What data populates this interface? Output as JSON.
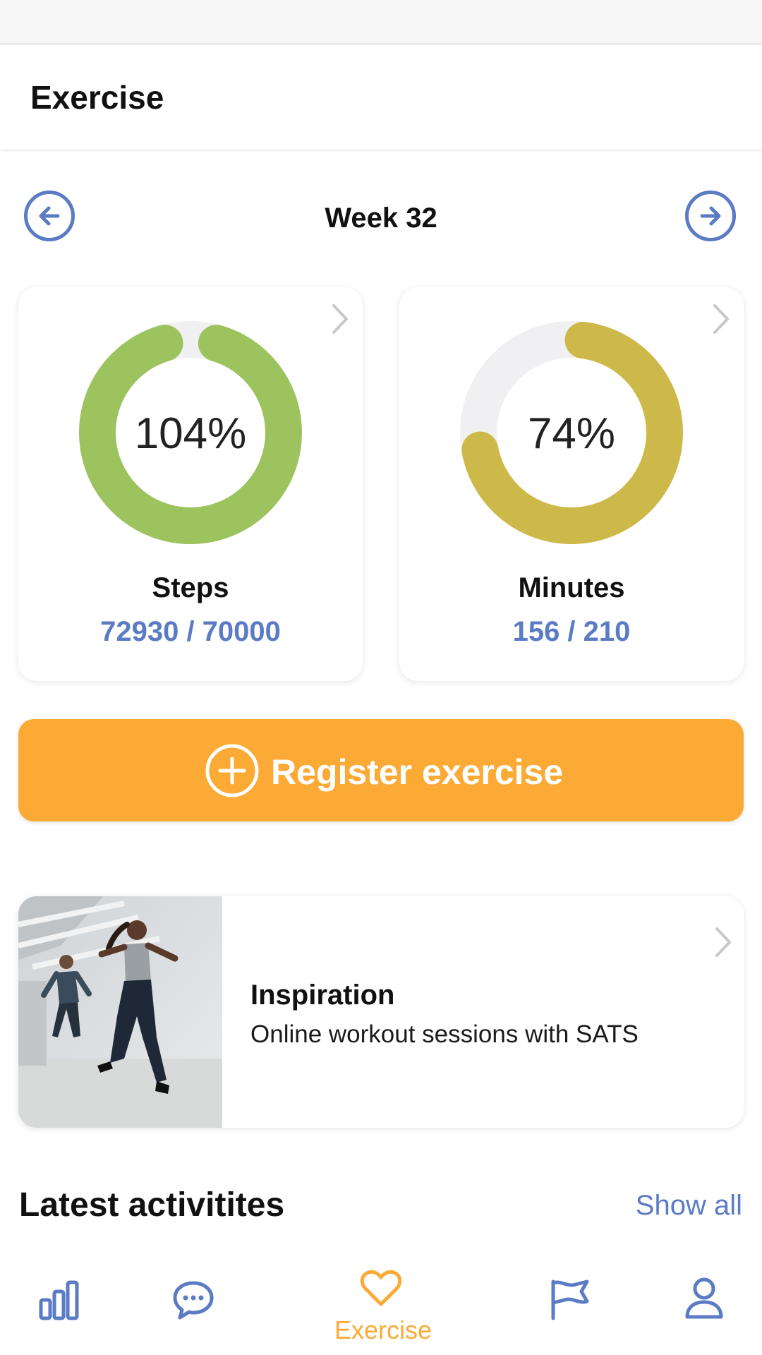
{
  "header": {
    "title": "Exercise"
  },
  "week_nav": {
    "label": "Week 32",
    "prev_icon": "arrow-left-circle",
    "next_icon": "arrow-right-circle"
  },
  "stats": {
    "steps": {
      "percent_label": "104%",
      "percent": 104,
      "name": "Steps",
      "value": "72930 / 70000",
      "color": "#9dc35e"
    },
    "minutes": {
      "percent_label": "74%",
      "percent": 74,
      "name": "Minutes",
      "value": "156 / 210",
      "color": "#cdb84a"
    }
  },
  "register": {
    "label": "Register exercise",
    "icon": "plus-circle"
  },
  "inspiration": {
    "title": "Inspiration",
    "subtitle": "Online workout sessions with SATS",
    "image": "workout-photo"
  },
  "latest": {
    "title": "Latest activitites",
    "show_all": "Show all"
  },
  "bottom_nav": {
    "items": [
      {
        "icon": "bar-chart-icon",
        "label": ""
      },
      {
        "icon": "chat-icon",
        "label": ""
      },
      {
        "icon": "heart-icon",
        "label": "Exercise",
        "active": true
      },
      {
        "icon": "flag-icon",
        "label": ""
      },
      {
        "icon": "person-icon",
        "label": ""
      }
    ]
  },
  "colors": {
    "accent": "#fbaa36",
    "blue": "#5b7bc4",
    "green": "#9dc35e",
    "olive": "#cdb84a",
    "track": "#f0f0f2"
  }
}
